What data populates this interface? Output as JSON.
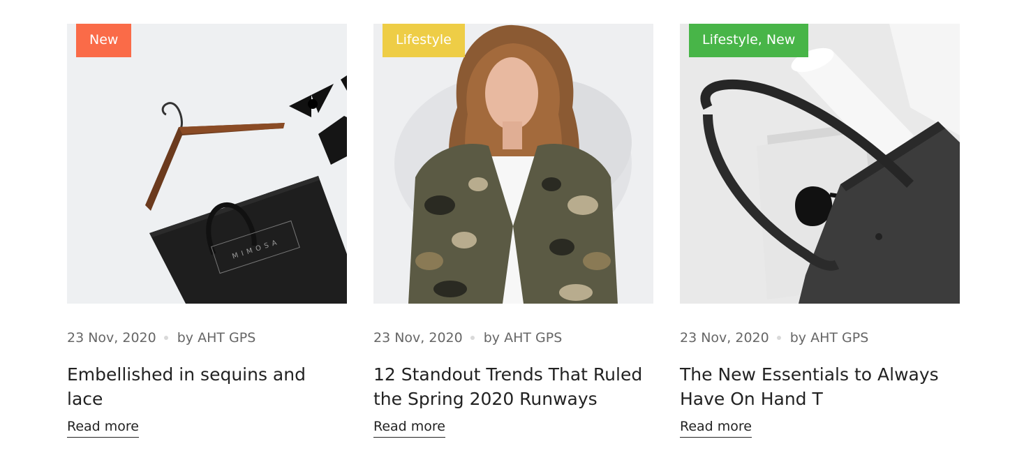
{
  "posts": [
    {
      "badge": "New",
      "badge_color": "#fa6b48",
      "date": "23 Nov, 2020",
      "author": "by AHT GPS",
      "title": "Embellished in sequins and lace",
      "read_more": "Read more",
      "image_icon": "hanger-and-shopping-bag-image",
      "bag_text": "MIMOSA"
    },
    {
      "badge": "Lifestyle",
      "badge_color": "#eecd46",
      "date": "23 Nov, 2020",
      "author": "by AHT GPS",
      "title": "12 Standout Trends That Ruled the Spring 2020 Runways",
      "read_more": "Read more",
      "image_icon": "woman-camo-jacket-image"
    },
    {
      "badge": "Lifestyle, New",
      "badge_color": "#48b548",
      "date": "23 Nov, 2020",
      "author": "by AHT GPS",
      "title": "The New Essentials to Always Have On Hand T",
      "read_more": "Read more",
      "image_icon": "tote-bag-sunglasses-image"
    }
  ]
}
